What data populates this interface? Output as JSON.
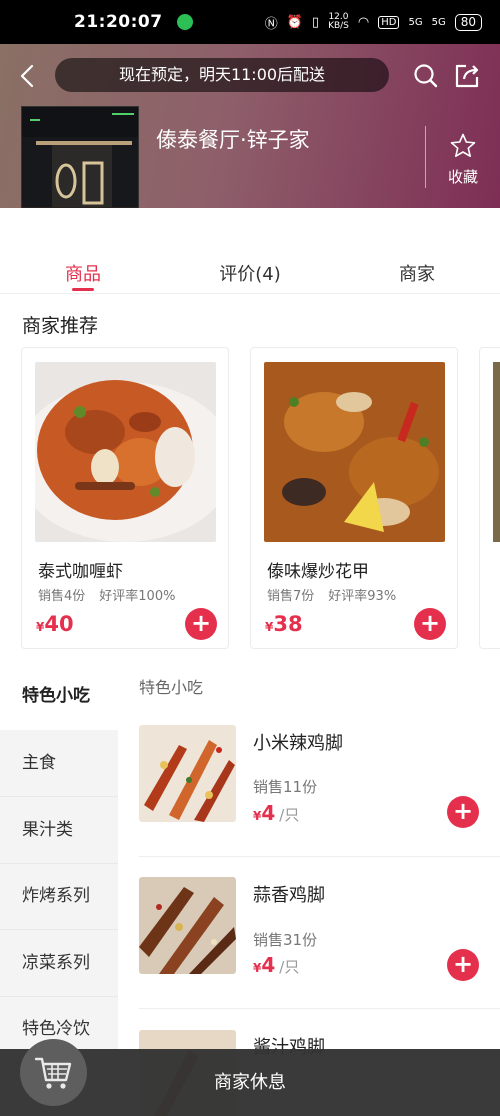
{
  "status_bar": {
    "time": "21:20:07",
    "network_speed_value": "12.0",
    "network_speed_unit": "KB/S",
    "hd_label": "HD",
    "signal1": "5G",
    "signal2": "5G",
    "battery": "80"
  },
  "header": {
    "delivery_notice": "现在预定，明天11:00后配送",
    "store_name": "傣泰餐厅·锌子家",
    "favorite_label": "收藏"
  },
  "tabs": [
    {
      "label": "商品",
      "active": true
    },
    {
      "label": "评价(4)",
      "active": false
    },
    {
      "label": "商家",
      "active": false
    }
  ],
  "recommendations": {
    "title": "商家推荐",
    "items": [
      {
        "name": "泰式咖喱虾",
        "sales": "销售4份",
        "rating": "好评率100%",
        "currency": "¥",
        "price": "40"
      },
      {
        "name": "傣味爆炒花甲",
        "sales": "销售7份",
        "rating": "好评率93%",
        "currency": "¥",
        "price": "38"
      }
    ]
  },
  "categories": [
    {
      "label": "特色小吃",
      "active": true
    },
    {
      "label": "主食",
      "active": false
    },
    {
      "label": "果汁类",
      "active": false
    },
    {
      "label": "炸烤系列",
      "active": false
    },
    {
      "label": "凉菜系列",
      "active": false
    },
    {
      "label": "特色冷饮",
      "active": false
    }
  ],
  "products": {
    "section_title": "特色小吃",
    "items": [
      {
        "name": "小米辣鸡脚",
        "sales": "销售11份",
        "currency": "¥",
        "price": "4",
        "unit": "/只"
      },
      {
        "name": "蒜香鸡脚",
        "sales": "销售31份",
        "currency": "¥",
        "price": "4",
        "unit": "/只"
      },
      {
        "name": "酱汁鸡脚"
      }
    ]
  },
  "bottom_bar": {
    "status_text": "商家休息"
  },
  "colors": {
    "accent": "#e5304d",
    "header_start": "#8a7065",
    "header_end": "#7e2e55",
    "bottom_bar": "#323232"
  }
}
